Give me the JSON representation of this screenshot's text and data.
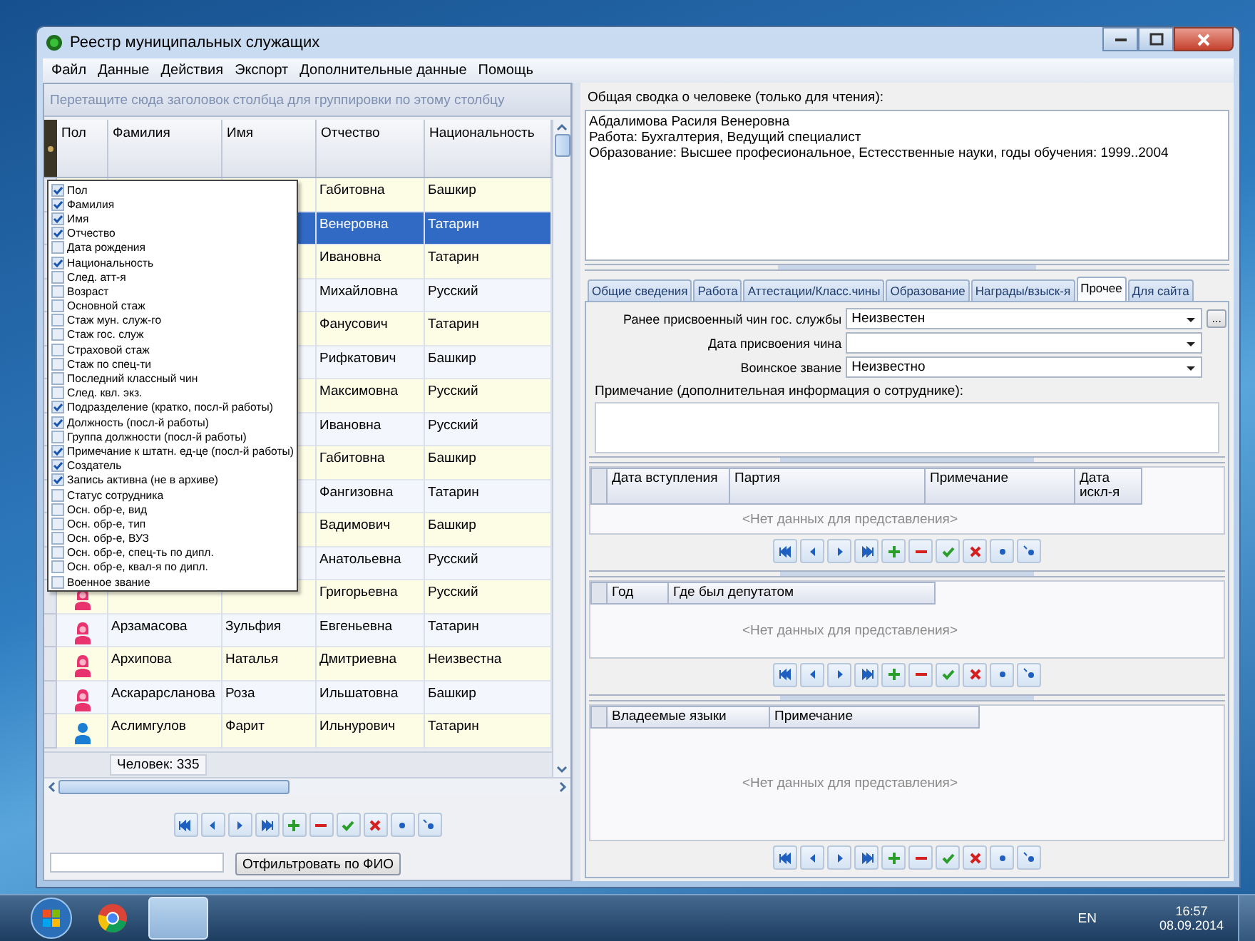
{
  "window": {
    "title": "Реестр муниципальных служащих"
  },
  "menu": [
    "Файл",
    "Данные",
    "Действия",
    "Экспорт",
    "Дополнительные данные",
    "Помощь"
  ],
  "left_panel": {
    "group_hint": "Перетащите сюда заголовок столбца для группировки по этому столбцу",
    "columns": [
      "Пол",
      "Фамилия",
      "Имя",
      "Отчество",
      "Национальность"
    ],
    "rows": [
      {
        "patronymic": "Габитовна",
        "nationality": "Башкир",
        "selected": false
      },
      {
        "patronymic": "Венеровна",
        "nationality": "Татарин",
        "selected": true
      },
      {
        "patronymic": "Ивановна",
        "nationality": "Татарин",
        "selected": false
      },
      {
        "patronymic": "Михайловна",
        "nationality": "Русский",
        "selected": false
      },
      {
        "patronymic": "Фанусович",
        "nationality": "Татарин",
        "selected": false
      },
      {
        "patronymic": "Рифкатович",
        "nationality": "Башкир",
        "selected": false
      },
      {
        "patronymic": "Максимовна",
        "nationality": "Русский",
        "selected": false
      },
      {
        "patronymic": "Ивановна",
        "nationality": "Русский",
        "selected": false
      },
      {
        "patronymic": "Габитовна",
        "nationality": "Башкир",
        "selected": false
      },
      {
        "patronymic": "Фангизовна",
        "nationality": "Татарин",
        "selected": false
      },
      {
        "patronymic": "Вадимович",
        "nationality": "Башкир",
        "selected": false
      },
      {
        "patronymic": "Анатольевна",
        "nationality": "Русский",
        "selected": false
      },
      {
        "kind": "female",
        "patronymic": "Григорьевна",
        "nationality": "Русский",
        "selected": false
      },
      {
        "kind": "female",
        "surname": "Арзамасова",
        "name": "Зульфия",
        "patronymic": "Евгеньевна",
        "nationality": "Татарин",
        "selected": false
      },
      {
        "kind": "female",
        "surname": "Архипова",
        "name": "Наталья",
        "patronymic": "Дмитриевна",
        "nationality": "Неизвестна",
        "selected": false
      },
      {
        "kind": "female",
        "surname": "Аскарарсланова",
        "name": "Роза",
        "patronymic": "Ильшатовна",
        "nationality": "Башкир",
        "selected": false
      },
      {
        "kind": "male",
        "surname": "Аслимгулов",
        "name": "Фарит",
        "patronymic": "Ильнурович",
        "nationality": "Татарин",
        "selected": false
      }
    ],
    "column_chooser": [
      {
        "label": "Пол",
        "checked": true
      },
      {
        "label": "Фамилия",
        "checked": true
      },
      {
        "label": "Имя",
        "checked": true
      },
      {
        "label": "Отчество",
        "checked": true
      },
      {
        "label": "Дата рождения",
        "checked": false
      },
      {
        "label": "Национальность",
        "checked": true
      },
      {
        "label": "След. атт-я",
        "checked": false
      },
      {
        "label": "Возраст",
        "checked": false
      },
      {
        "label": "Основной стаж",
        "checked": false
      },
      {
        "label": "Стаж мун. служ-го",
        "checked": false
      },
      {
        "label": "Стаж гос. служ",
        "checked": false
      },
      {
        "label": "Страховой стаж",
        "checked": false
      },
      {
        "label": "Стаж по спец-ти",
        "checked": false
      },
      {
        "label": "Последний классный чин",
        "checked": false
      },
      {
        "label": "След. квл. экз.",
        "checked": false
      },
      {
        "label": "Подразделение (кратко, посл-й работы)",
        "checked": true
      },
      {
        "label": "Должность (посл-й работы)",
        "checked": true
      },
      {
        "label": "Группа должности (посл-й работы)",
        "checked": false
      },
      {
        "label": "Примечание к штатн. ед-це (посл-й работы)",
        "checked": true
      },
      {
        "label": "Создатель",
        "checked": true
      },
      {
        "label": "Запись активна (не в архиве)",
        "checked": true
      },
      {
        "label": "Статус сотрудника",
        "checked": false
      },
      {
        "label": "Осн. обр-е, вид",
        "checked": false
      },
      {
        "label": "Осн. обр-е, тип",
        "checked": false
      },
      {
        "label": "Осн. обр-е, ВУЗ",
        "checked": false
      },
      {
        "label": "Осн. обр-е, спец-ть по дипл.",
        "checked": false
      },
      {
        "label": "Осн. обр-е, квал-я по дипл.",
        "checked": false
      },
      {
        "label": "Военное звание",
        "checked": false
      }
    ],
    "record_count": "Человек: 335",
    "filter_button": "Отфильтровать по ФИО"
  },
  "right_panel": {
    "summary_label": "Общая сводка о человеке (только для чтения):",
    "summary_lines": [
      "Абдалимова Расиля Венеровна",
      "Работа: Бухгалтерия, Ведущий специалист",
      "Образование: Высшее професиональное, Естесственные науки, годы обучения: 1999..2004"
    ],
    "tabs": [
      {
        "label": "Общие сведения",
        "selected": false
      },
      {
        "label": "Работа",
        "selected": false
      },
      {
        "label": "Аттестации/Класс.чины",
        "selected": false
      },
      {
        "label": "Образование",
        "selected": false
      },
      {
        "label": "Награды/взыск-я",
        "selected": false
      },
      {
        "label": "Прочее",
        "selected": true
      },
      {
        "label": "Для сайта",
        "selected": false
      }
    ],
    "fields": [
      {
        "label": "Ранее присвоенный чин гос. службы",
        "value": "Неизвестен",
        "button": "..."
      },
      {
        "label": "Дата присвоения чина"
      },
      {
        "label": "Воинское звание",
        "value": "Неизвестно"
      }
    ],
    "note_label": "Примечание (дополнительная информация о сотруднике):",
    "sections": [
      {
        "columns": [
          "Дата вступления",
          "Партия",
          "Примечание",
          "Дата искл-я"
        ],
        "empty_text": "<Нет данных для представления>"
      },
      {
        "columns": [
          "Год",
          "Где был депутатом"
        ],
        "empty_text": "<Нет данных для представления>"
      },
      {
        "columns": [
          "Владеемые языки",
          "Примечание"
        ],
        "empty_text": "<Нет данных для представления>"
      }
    ]
  },
  "taskbar": {
    "language": "EN",
    "time": "16:57",
    "date": "08.09.2014"
  }
}
